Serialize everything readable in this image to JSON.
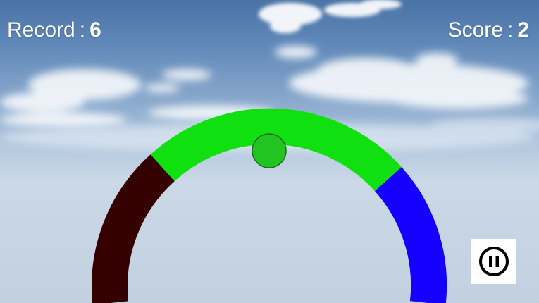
{
  "hud": {
    "record_label": "Record",
    "record_value": "6",
    "separator": ":",
    "score_label": "Score",
    "score_value": "2"
  },
  "ring": {
    "segments": [
      {
        "name": "dark-red-segment",
        "color": "#350000"
      },
      {
        "name": "green-segment",
        "color": "#10e010"
      },
      {
        "name": "blue-segment",
        "color": "#1500ff"
      }
    ]
  },
  "ball": {
    "color": "#22c422"
  },
  "controls": {
    "pause_icon": "pause-icon"
  }
}
